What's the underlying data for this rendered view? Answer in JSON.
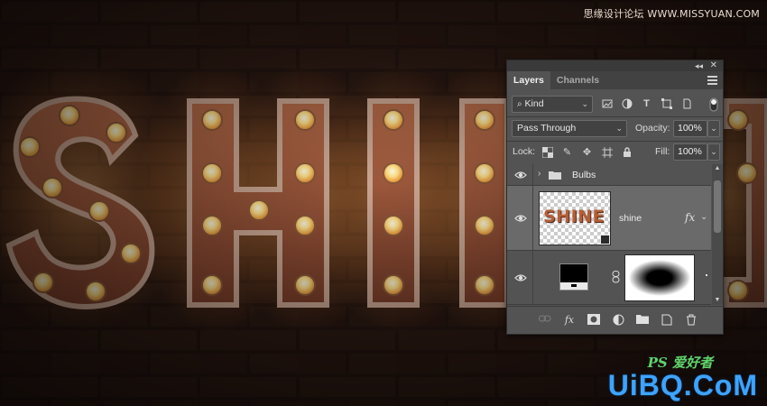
{
  "artwork": {
    "title_text": "SHINE",
    "watermark_top": "思缘设计论坛 WWW.MISSYUAN.COM",
    "watermark_ps": "PS 爱好者",
    "watermark_bottom": "UiBQ.CoM"
  },
  "panel": {
    "tabs": [
      {
        "label": "Layers",
        "active": true
      },
      {
        "label": "Channels",
        "active": false
      }
    ],
    "filter": {
      "icon": "search-icon",
      "label": "Kind"
    },
    "blend_mode": "Pass Through",
    "opacity_label": "Opacity:",
    "opacity_value": "100%",
    "lock_label": "Lock:",
    "fill_label": "Fill:",
    "fill_value": "100%",
    "layers": [
      {
        "name": "Bulbs",
        "type": "group",
        "visible": true
      },
      {
        "name": "shine",
        "type": "text",
        "visible": true,
        "fx": "fx",
        "thumb_text": "SHINE"
      },
      {
        "name": "",
        "type": "masked",
        "visible": true
      }
    ],
    "footer_icons": [
      "link-icon",
      "fx-icon",
      "mask-icon",
      "adjustment-icon",
      "folder-icon",
      "new-layer-icon",
      "trash-icon"
    ],
    "fx_label": "fx"
  },
  "colors": {
    "bulb": "#ffe08a",
    "letter_face": "#8a4a34",
    "panel_bg": "#535353",
    "watermark_blue": "#3da3ff"
  }
}
